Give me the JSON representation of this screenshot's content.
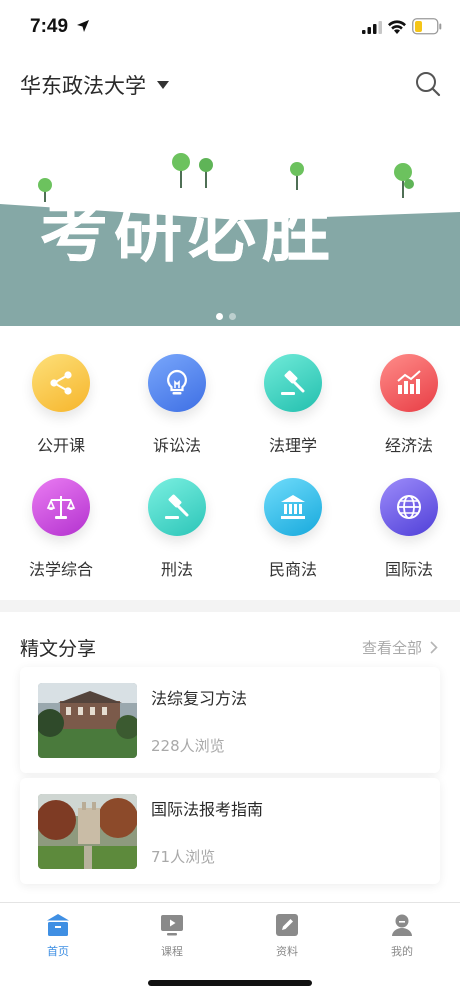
{
  "status_bar": {
    "time": "7:49"
  },
  "header": {
    "school": "华东政法大学"
  },
  "banner": {
    "text": "考研必胜",
    "active_slide": 1,
    "slide_count": 2
  },
  "categories": [
    {
      "label": "公开课",
      "icon": "share-icon",
      "color": "#f9c33a"
    },
    {
      "label": "诉讼法",
      "icon": "lightbulb-icon",
      "color": "#4f87f0"
    },
    {
      "label": "法理学",
      "icon": "gavel-icon",
      "color": "#38d1bf"
    },
    {
      "label": "经济法",
      "icon": "chart-icon",
      "color": "#f0545a"
    },
    {
      "label": "法学综合",
      "icon": "scales-icon",
      "color": "#c64ad6"
    },
    {
      "label": "刑法",
      "icon": "gavel-icon",
      "color": "#3fd3c4"
    },
    {
      "label": "民商法",
      "icon": "institution-icon",
      "color": "#2ec0ea"
    },
    {
      "label": "国际法",
      "icon": "globe-icon",
      "color": "#6553e6"
    }
  ],
  "articles": {
    "title": "精文分享",
    "see_all": "查看全部",
    "items": [
      {
        "title": "法综复习方法",
        "views": "228人浏览"
      },
      {
        "title": "国际法报考指南",
        "views": "71人浏览"
      }
    ]
  },
  "tabbar": {
    "items": [
      {
        "label": "首页",
        "icon": "home-icon",
        "active": true
      },
      {
        "label": "课程",
        "icon": "course-icon",
        "active": false
      },
      {
        "label": "资料",
        "icon": "document-icon",
        "active": false
      },
      {
        "label": "我的",
        "icon": "user-icon",
        "active": false
      }
    ]
  }
}
